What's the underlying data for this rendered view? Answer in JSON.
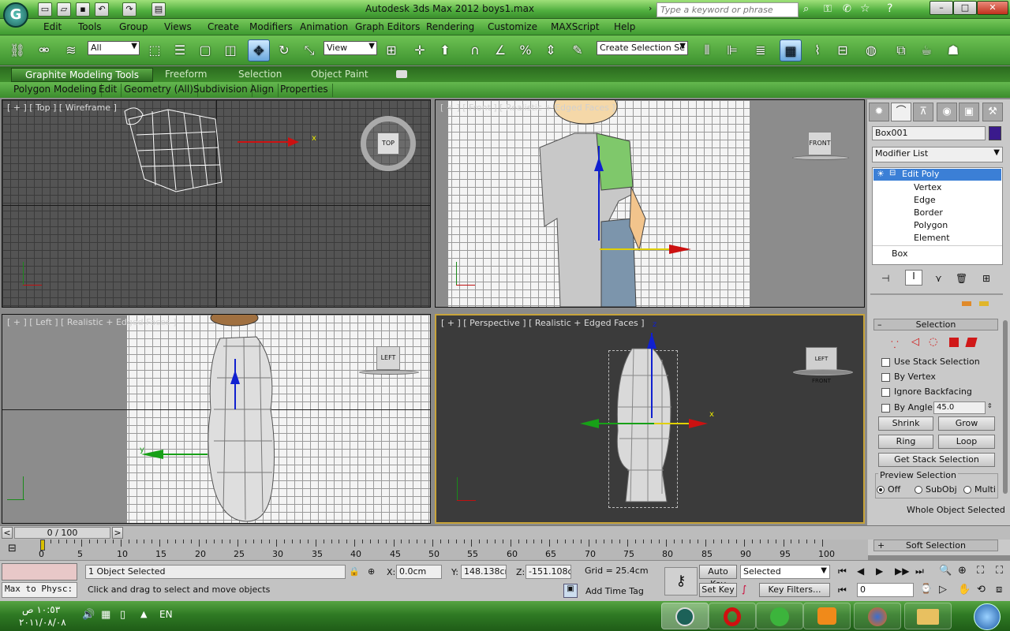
{
  "window": {
    "title": "Autodesk 3ds Max  2012    boys1.max",
    "search_placeholder": "Type a keyword or phrase"
  },
  "menu": [
    "Edit",
    "Tools",
    "Group",
    "Views",
    "Create",
    "Modifiers",
    "Animation",
    "Graph Editors",
    "Rendering",
    "Customize",
    "MAXScript",
    "Help"
  ],
  "toolbar": {
    "filter_value": "All",
    "ref_coord_value": "View",
    "selection_set_value": "Create Selection Se"
  },
  "ribbon": {
    "tabs": [
      "Graphite Modeling Tools",
      "Freeform",
      "Selection",
      "Object Paint"
    ],
    "sub_items": [
      "Polygon Modeling",
      "Edit",
      "Geometry (All)",
      "Subdivision",
      "Align",
      "Properties"
    ]
  },
  "viewports": {
    "top": "[ + ] [ Top ] [ Wireframe ]",
    "front": "[ + ] [ Front ] [ Realistic + Edged Faces ]",
    "left": "[ + ] [ Left ] [ Realistic + Edged Faces ]",
    "perspective": "[ + ] [ Perspective ] [ Realistic + Edged Faces ]",
    "viewcube_top": "TOP",
    "viewcube_front": "FRONT",
    "viewcube_left": "LEFT",
    "viewcube_persp": "LEFT  FRONT",
    "axis_x": "x",
    "axis_y": "y",
    "axis_z": "z"
  },
  "command_panel": {
    "object_name": "Box001",
    "modifier_list": "Modifier List",
    "stack": [
      {
        "label": "Edit Poly",
        "selected": true
      },
      {
        "label": "Vertex",
        "selected": false
      },
      {
        "label": "Edge",
        "selected": false
      },
      {
        "label": "Border",
        "selected": false
      },
      {
        "label": "Polygon",
        "selected": false
      },
      {
        "label": "Element",
        "selected": false
      },
      {
        "label": "Box",
        "selected": false
      }
    ],
    "selection_rollout": {
      "title": "Selection",
      "collapse_glyph": "–",
      "use_stack": "Use Stack Selection",
      "by_vertex": "By Vertex",
      "ignore_backfacing": "Ignore Backfacing",
      "by_angle": "By Angle:",
      "angle_value": "45.0",
      "shrink": "Shrink",
      "grow": "Grow",
      "ring": "Ring",
      "loop": "Loop",
      "get_stack": "Get Stack Selection",
      "preview_title": "Preview Selection",
      "preview_off": "Off",
      "preview_subobj": "SubObj",
      "preview_multi": "Multi",
      "status": "Whole Object Selected"
    },
    "soft_selection": {
      "title": "Soft Selection",
      "expand_glyph": "+"
    },
    "object_color": "#3a1a8c"
  },
  "timeline": {
    "frame_display": "0 / 100",
    "prev": "<",
    "next": ">",
    "frame": 0,
    "total": 100,
    "ticks": [
      "0",
      "5",
      "10",
      "15",
      "20",
      "25",
      "30",
      "35",
      "40",
      "45",
      "50",
      "55",
      "60",
      "65",
      "70",
      "75",
      "80",
      "85",
      "90",
      "95",
      "100"
    ]
  },
  "status": {
    "maxscript": "Max to Physc:",
    "selected": "1 Object Selected",
    "prompt": "Click and drag to select and move objects",
    "x_label": "X:",
    "x": "0.0cm",
    "y_label": "Y:",
    "y": "148.138cm",
    "z_label": "Z:",
    "z": "-151.108cm",
    "grid": "Grid = 25.4cm",
    "add_time_tag": "Add Time Tag",
    "auto_key": "Auto Key",
    "set_key": "Set Key",
    "key_mode": "Selected",
    "key_filters": "Key Filters...",
    "current_frame": "0"
  },
  "taskbar": {
    "time": "١٠:٥٣ ص",
    "date": "٢٠١١/٠٨/٠٨",
    "lang": "EN"
  },
  "colors": {
    "title_green": "#4fae3e",
    "selected_blue": "#3b7fd6",
    "axis_red": "#cc1111",
    "axis_green": "#17a017",
    "axis_blue": "#1020d0",
    "perspective_border": "#c8a43a"
  }
}
